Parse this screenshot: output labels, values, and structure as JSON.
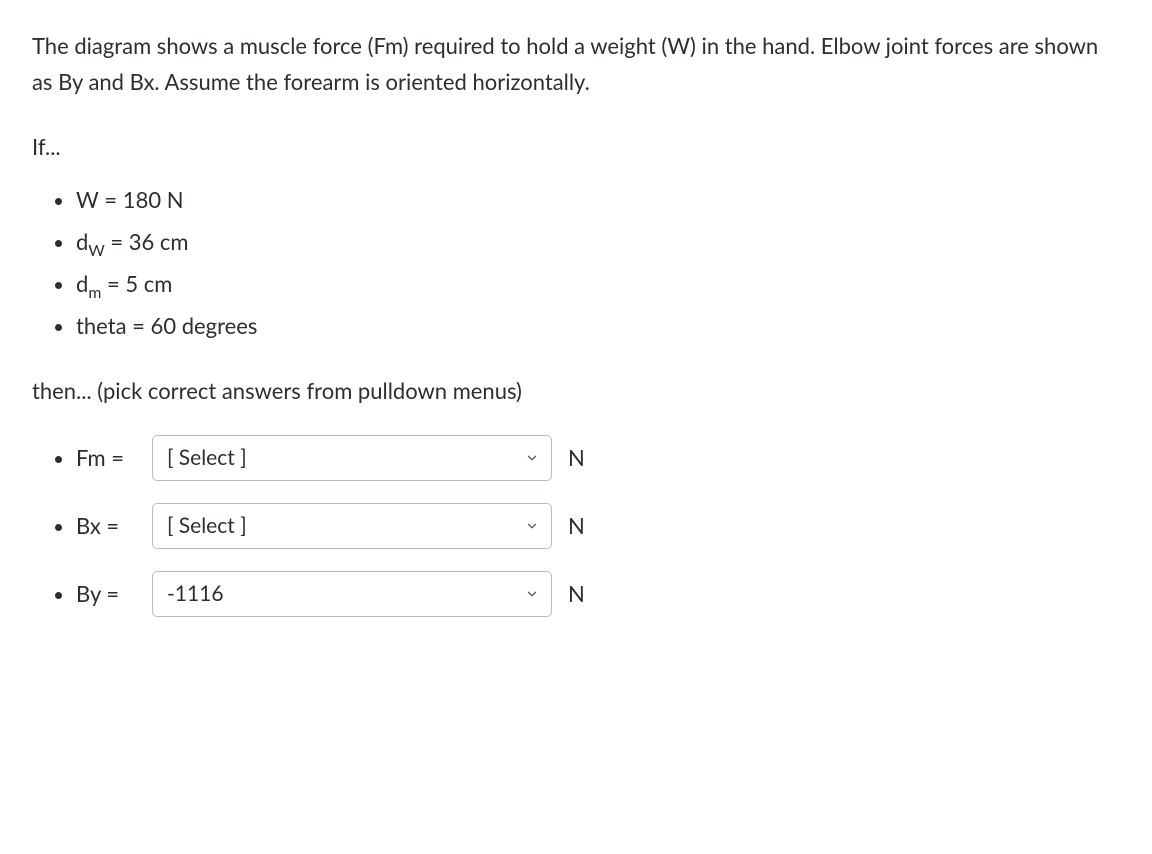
{
  "intro": "The diagram shows a muscle force (Fm) required to hold a weight (W) in the hand.  Elbow joint forces are shown as By and Bx.  Assume the forearm is oriented horizontally.",
  "if_label": "If...",
  "given": [
    {
      "var": "W",
      "sub": "",
      "eq": " = 180 N"
    },
    {
      "var": "d",
      "sub": "W",
      "eq": " = 36 cm"
    },
    {
      "var": "d",
      "sub": "m",
      "eq": " = 5 cm"
    },
    {
      "var": "theta",
      "sub": "",
      "eq": " = 60 degrees"
    }
  ],
  "then_label": "then... (pick correct answers from pulldown menus)",
  "answers": [
    {
      "label": "Fm =",
      "value": "[ Select ]",
      "unit": "N"
    },
    {
      "label": "Bx =",
      "value": "[ Select ]",
      "unit": "N"
    },
    {
      "label": "By =",
      "value": "-1116",
      "unit": "N"
    }
  ]
}
